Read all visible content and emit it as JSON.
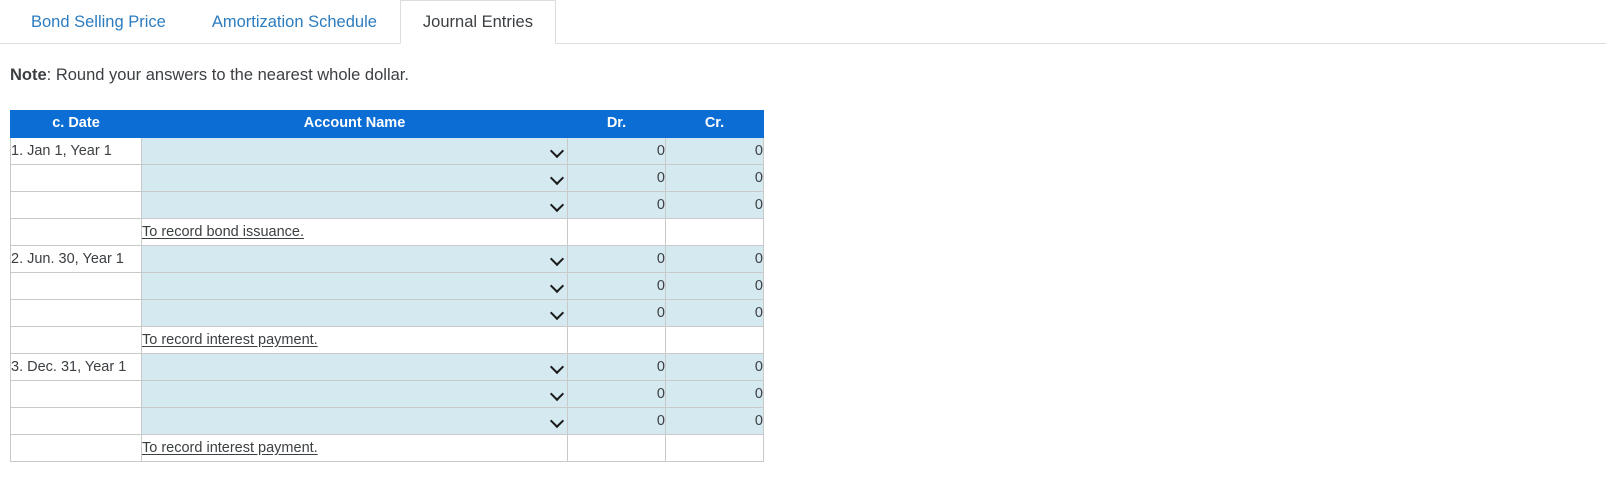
{
  "tabs": [
    {
      "label": "Bond Selling Price",
      "active": false
    },
    {
      "label": "Amortization Schedule",
      "active": false
    },
    {
      "label": "Journal Entries",
      "active": true
    }
  ],
  "note": {
    "label": "Note",
    "text": ": Round your answers to the nearest whole dollar."
  },
  "colors": {
    "header_blue": "#0c6dd4",
    "input_fill": "#d5e9f0",
    "tab_link": "#2c7cc0",
    "text": "#3c4043",
    "border": "#c9c9c9"
  },
  "table": {
    "columns": [
      "c. Date",
      "Account Name",
      "Dr.",
      "Cr."
    ],
    "dropdown_icon": "chevron-down-icon",
    "entries": [
      {
        "date": "1. Jan 1, Year 1",
        "lines": [
          {
            "account": "",
            "dr": "0",
            "cr": "0"
          },
          {
            "account": "",
            "dr": "0",
            "cr": "0"
          },
          {
            "account": "",
            "dr": "0",
            "cr": "0"
          }
        ],
        "description": "To record bond issuance."
      },
      {
        "date": "2. Jun. 30, Year 1",
        "lines": [
          {
            "account": "",
            "dr": "0",
            "cr": "0"
          },
          {
            "account": "",
            "dr": "0",
            "cr": "0"
          },
          {
            "account": "",
            "dr": "0",
            "cr": "0"
          }
        ],
        "description": "To record interest payment."
      },
      {
        "date": "3. Dec. 31, Year 1",
        "lines": [
          {
            "account": "",
            "dr": "0",
            "cr": "0"
          },
          {
            "account": "",
            "dr": "0",
            "cr": "0"
          },
          {
            "account": "",
            "dr": "0",
            "cr": "0"
          }
        ],
        "description": "To record interest payment."
      }
    ]
  }
}
